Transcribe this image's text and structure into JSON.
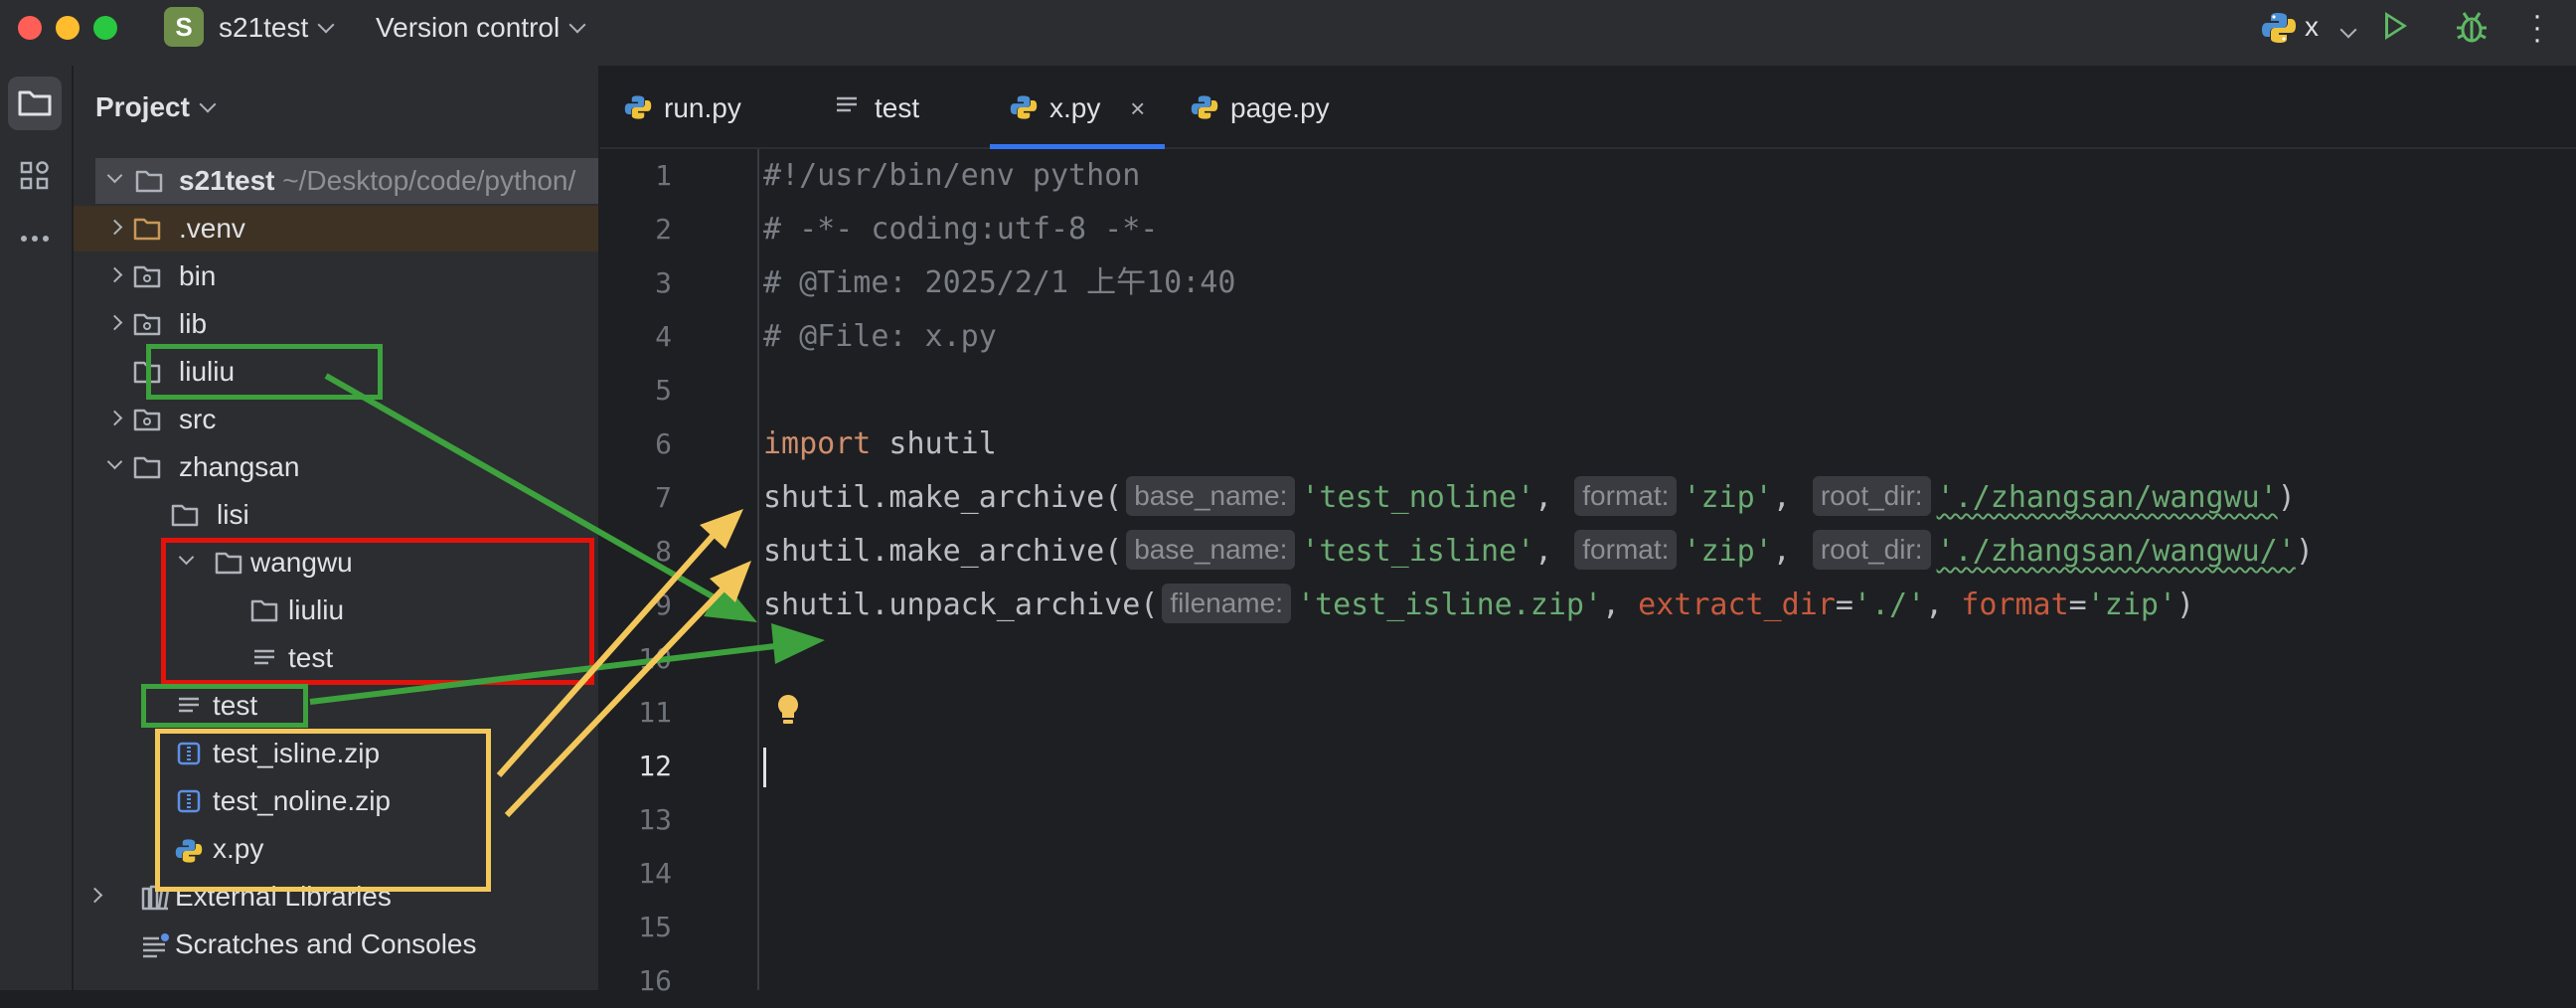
{
  "titlebar": {
    "project_badge": "S",
    "project_name": "s21test",
    "vcs_label": "Version control",
    "run_config": "x",
    "icons": [
      "python-icon",
      "run-icon",
      "debug-icon",
      "more-icon"
    ]
  },
  "project_panel": {
    "title": "Project",
    "root": {
      "name": "s21test",
      "path": "~/Desktop/code/python/"
    },
    "items": [
      {
        "label": ".venv",
        "icon": "folder-icon"
      },
      {
        "label": "bin",
        "icon": "source-folder-icon"
      },
      {
        "label": "lib",
        "icon": "source-folder-icon"
      },
      {
        "label": "liuliu",
        "icon": "folder-icon"
      },
      {
        "label": "src",
        "icon": "source-folder-icon"
      },
      {
        "label": "zhangsan",
        "icon": "folder-icon"
      },
      {
        "label": "lisi",
        "icon": "folder-icon"
      },
      {
        "label": "wangwu",
        "icon": "folder-icon"
      },
      {
        "label": "liuliu",
        "icon": "folder-icon"
      },
      {
        "label": "test",
        "icon": "text-file-icon"
      },
      {
        "label": "test",
        "icon": "text-file-icon"
      },
      {
        "label": "test_isline.zip",
        "icon": "archive-icon"
      },
      {
        "label": "test_noline.zip",
        "icon": "archive-icon"
      },
      {
        "label": "x.py",
        "icon": "python-file-icon"
      },
      {
        "label": "External Libraries",
        "icon": "library-icon"
      },
      {
        "label": "Scratches and Consoles",
        "icon": "scratches-icon"
      }
    ]
  },
  "tabs": [
    {
      "label": "run.py",
      "icon": "python-file-icon"
    },
    {
      "label": "test",
      "icon": "text-file-icon"
    },
    {
      "label": "x.py",
      "icon": "python-file-icon",
      "active": true,
      "close": "×"
    },
    {
      "label": "page.py",
      "icon": "python-file-icon"
    }
  ],
  "editor": {
    "line_numbers": [
      "1",
      "2",
      "3",
      "4",
      "5",
      "6",
      "7",
      "8",
      "9",
      "10",
      "11",
      "12",
      "13",
      "14",
      "15",
      "16"
    ],
    "current_line": "12",
    "lines": {
      "l1": "#!/usr/bin/env python",
      "l2": "# -*- coding:utf-8 -*-",
      "l3": "# @Time: 2025/2/1 上午10:40",
      "l4": "# @File: x.py",
      "l6_kw": "import",
      "l6_mod": " shutil",
      "l7_fn": "shutil.make_archive(",
      "l7_h1": "base_name:",
      "l7_v1": "'test_noline'",
      "l7_h2": "format:",
      "l7_v2": "'zip'",
      "l7_h3": "root_dir:",
      "l7_v3": "'./zhangsan/wangwu'",
      "l8_fn": "shutil.make_archive(",
      "l8_h1": "base_name:",
      "l8_v1": "'test_isline'",
      "l8_h2": "format:",
      "l8_v2": "'zip'",
      "l8_h3": "root_dir:",
      "l8_v3": "'./zhangsan/wangwu/'",
      "l9_fn": "shutil.unpack_archive(",
      "l9_h1": "filename:",
      "l9_v1": "'test_isline.zip'",
      "l9_k2": "extract_dir",
      "l9_v2": "'./'",
      "l9_k3": "format",
      "l9_v3": "'zip'"
    }
  },
  "colors": {
    "green_annotation": "#3da13d",
    "red_annotation": "#e3120b",
    "yellow_annotation": "#f3c75a",
    "accent": "#3574f0"
  }
}
